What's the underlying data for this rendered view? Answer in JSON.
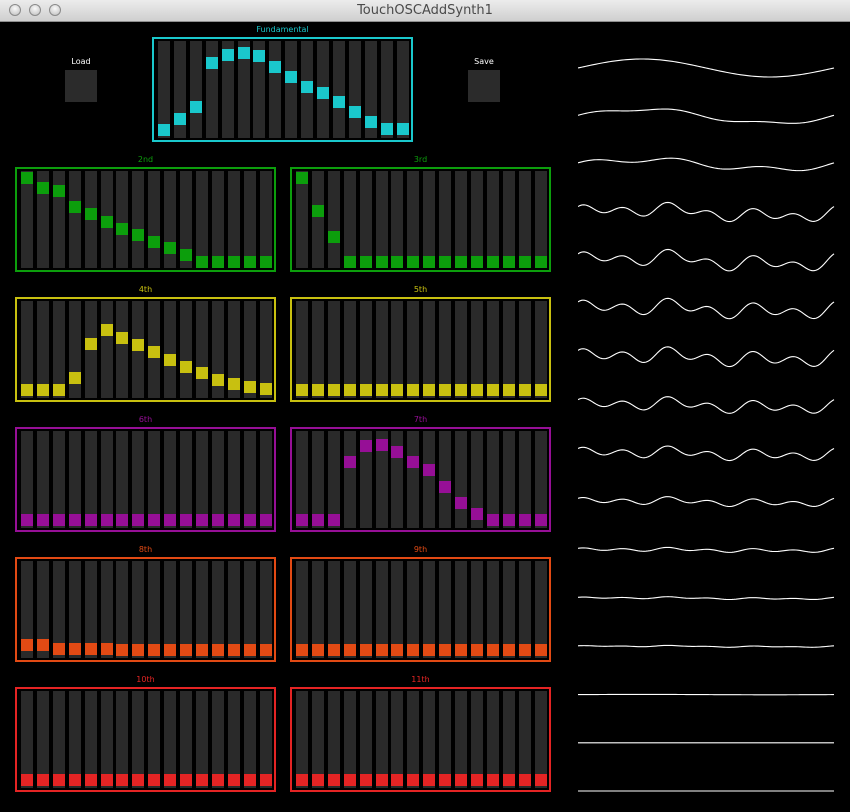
{
  "window": {
    "title": "TouchOSCAddSynth1"
  },
  "buttons": {
    "load_label": "Load",
    "save_label": "Save"
  },
  "panels": [
    {
      "label": "Fundamental",
      "color": "#1ac8cc",
      "values": [
        0.02,
        0.15,
        0.3,
        0.81,
        0.91,
        0.93,
        0.89,
        0.77,
        0.65,
        0.53,
        0.46,
        0.35,
        0.23,
        0.12,
        0.03,
        0.03
      ]
    },
    {
      "label": "2nd",
      "color": "#0c9e0c",
      "values": [
        0.99,
        0.87,
        0.83,
        0.65,
        0.57,
        0.47,
        0.39,
        0.32,
        0.24,
        0.17,
        0.08,
        0.0,
        0.0,
        0.0,
        0.0,
        0.0
      ]
    },
    {
      "label": "3rd",
      "color": "#0c9e0c",
      "values": [
        0.99,
        0.6,
        0.29,
        0.0,
        0.0,
        0.0,
        0.0,
        0.0,
        0.0,
        0.0,
        0.0,
        0.0,
        0.0,
        0.0,
        0.0,
        0.0
      ]
    },
    {
      "label": "4th",
      "color": "#c8c010",
      "values": [
        0.02,
        0.02,
        0.02,
        0.16,
        0.57,
        0.73,
        0.64,
        0.55,
        0.47,
        0.38,
        0.3,
        0.22,
        0.14,
        0.09,
        0.06,
        0.03
      ]
    },
    {
      "label": "5th",
      "color": "#c8c010",
      "values": [
        0.02,
        0.02,
        0.02,
        0.02,
        0.02,
        0.02,
        0.02,
        0.02,
        0.02,
        0.02,
        0.02,
        0.02,
        0.02,
        0.02,
        0.02,
        0.02
      ]
    },
    {
      "label": "6th",
      "color": "#960f96",
      "values": [
        0.02,
        0.02,
        0.02,
        0.02,
        0.02,
        0.02,
        0.02,
        0.02,
        0.02,
        0.02,
        0.02,
        0.02,
        0.02,
        0.02,
        0.02,
        0.02
      ]
    },
    {
      "label": "7th",
      "color": "#960f96",
      "values": [
        0.02,
        0.02,
        0.02,
        0.71,
        0.9,
        0.91,
        0.82,
        0.71,
        0.61,
        0.41,
        0.22,
        0.09,
        0.02,
        0.02,
        0.02,
        0.02
      ]
    },
    {
      "label": "8th",
      "color": "#e24a14",
      "values": [
        0.08,
        0.08,
        0.03,
        0.03,
        0.03,
        0.03,
        0.02,
        0.02,
        0.02,
        0.02,
        0.02,
        0.02,
        0.02,
        0.02,
        0.02,
        0.02
      ]
    },
    {
      "label": "9th",
      "color": "#e24a14",
      "values": [
        0.02,
        0.02,
        0.02,
        0.02,
        0.02,
        0.02,
        0.02,
        0.02,
        0.02,
        0.02,
        0.02,
        0.02,
        0.02,
        0.02,
        0.02,
        0.02
      ]
    },
    {
      "label": "10th",
      "color": "#e42424",
      "values": [
        0.02,
        0.02,
        0.02,
        0.02,
        0.02,
        0.02,
        0.02,
        0.02,
        0.02,
        0.02,
        0.02,
        0.02,
        0.02,
        0.02,
        0.02,
        0.02
      ]
    },
    {
      "label": "11th",
      "color": "#e42424",
      "values": [
        0.02,
        0.02,
        0.02,
        0.02,
        0.02,
        0.02,
        0.02,
        0.02,
        0.02,
        0.02,
        0.02,
        0.02,
        0.02,
        0.02,
        0.02,
        0.02
      ]
    }
  ],
  "waves": [
    {
      "amps": [
        1.0,
        0.0,
        0.0,
        0.0
      ]
    },
    {
      "amps": [
        0.8,
        0.18,
        0.0,
        0.0
      ]
    },
    {
      "amps": [
        0.55,
        0.3,
        0.0,
        0.0
      ]
    },
    {
      "amps": [
        0.4,
        0.4,
        0.5,
        0.0
      ]
    },
    {
      "amps": [
        0.4,
        0.5,
        0.55,
        0.0
      ]
    },
    {
      "amps": [
        0.3,
        0.45,
        0.6,
        0.0
      ]
    },
    {
      "amps": [
        0.3,
        0.4,
        0.6,
        0.0
      ]
    },
    {
      "amps": [
        0.25,
        0.35,
        0.5,
        0.0
      ]
    },
    {
      "amps": [
        0.2,
        0.3,
        0.45,
        0.0
      ]
    },
    {
      "amps": [
        0.15,
        0.2,
        0.3,
        0.0
      ]
    },
    {
      "amps": [
        0.08,
        0.1,
        0.15,
        0.0
      ]
    },
    {
      "amps": [
        0.06,
        0.06,
        0.07,
        0.0
      ]
    },
    {
      "amps": [
        0.04,
        0.05,
        0.04,
        0.0
      ]
    },
    {
      "amps": [
        0.02,
        0.0,
        0.0,
        0.0
      ]
    },
    {
      "amps": [
        0.0,
        0.0,
        0.0,
        0.0
      ]
    },
    {
      "amps": [
        0.0,
        0.0,
        0.0,
        0.0
      ]
    }
  ]
}
